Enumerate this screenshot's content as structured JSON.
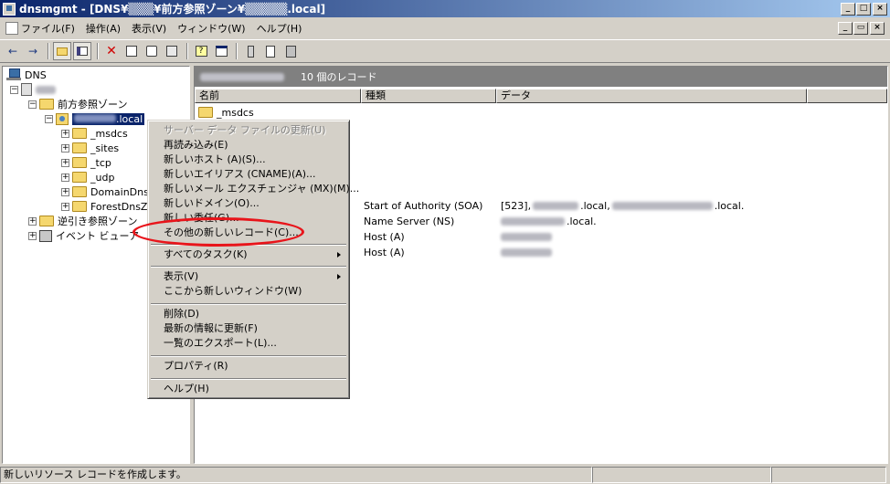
{
  "window": {
    "title": "dnsmgmt - [DNS¥▒▒▒¥前方参照ゾーン¥▒▒▒▒▒.local]",
    "min": "_",
    "max": "□",
    "close": "×"
  },
  "menubar": {
    "items": [
      "ファイル(F)",
      "操作(A)",
      "表示(V)",
      "ウィンドウ(W)",
      "ヘルプ(H)"
    ],
    "child_min": "_",
    "child_restore": "▭",
    "child_close": "×"
  },
  "toolbar": {
    "back": "←",
    "forward": "→",
    "delete": "✕"
  },
  "tree": {
    "root": "DNS",
    "forward_zones": "前方参照ゾーン",
    "zone_suffix": ".local",
    "children": [
      "_msdcs",
      "_sites",
      "_tcp",
      "_udp",
      "DomainDnsZ",
      "ForestDnsZ"
    ],
    "reverse_zones": "逆引き参照ゾーン",
    "event_viewer": "イベント ビューア"
  },
  "rightpane": {
    "header_count": "10 個のレコード",
    "columns": [
      "名前",
      "種類",
      "データ"
    ],
    "rows": [
      {
        "name": "_msdcs",
        "type": "",
        "data": ""
      },
      {
        "name": "",
        "type": "Start of Authority (SOA)",
        "data_prefix": "[523],",
        "data_mid": ".local,",
        "data_end": ".local."
      },
      {
        "name": "",
        "type": "Name Server (NS)",
        "data_end": ".local."
      },
      {
        "name": "",
        "type": "Host (A)",
        "data_end": ""
      },
      {
        "name": "",
        "type": "Host (A)",
        "data_end": ""
      }
    ]
  },
  "context_menu": {
    "items": [
      {
        "label": "サーバー データ ファイルの更新(U)",
        "disabled": true
      },
      {
        "label": "再読み込み(E)"
      },
      {
        "label": "新しいホスト (A)(S)..."
      },
      {
        "label": "新しいエイリアス (CNAME)(A)..."
      },
      {
        "label": "新しいメール エクスチェンジャ (MX)(M)..."
      },
      {
        "label": "新しいドメイン(O)..."
      },
      {
        "label": "新しい委任(G)..."
      },
      {
        "label": "その他の新しいレコード(C)..."
      },
      {
        "label": "すべてのタスク(K)",
        "submenu": true
      },
      {
        "label": "表示(V)",
        "submenu": true
      },
      {
        "label": "ここから新しいウィンドウ(W)"
      },
      {
        "label": "削除(D)"
      },
      {
        "label": "最新の情報に更新(F)"
      },
      {
        "label": "一覧のエクスポート(L)..."
      },
      {
        "label": "プロパティ(R)"
      },
      {
        "label": "ヘルプ(H)"
      }
    ]
  },
  "statusbar": {
    "text": "新しいリソース レコードを作成します。"
  },
  "colors": {
    "annotation": "#e8141a",
    "titlebar_start": "#0a246a"
  }
}
